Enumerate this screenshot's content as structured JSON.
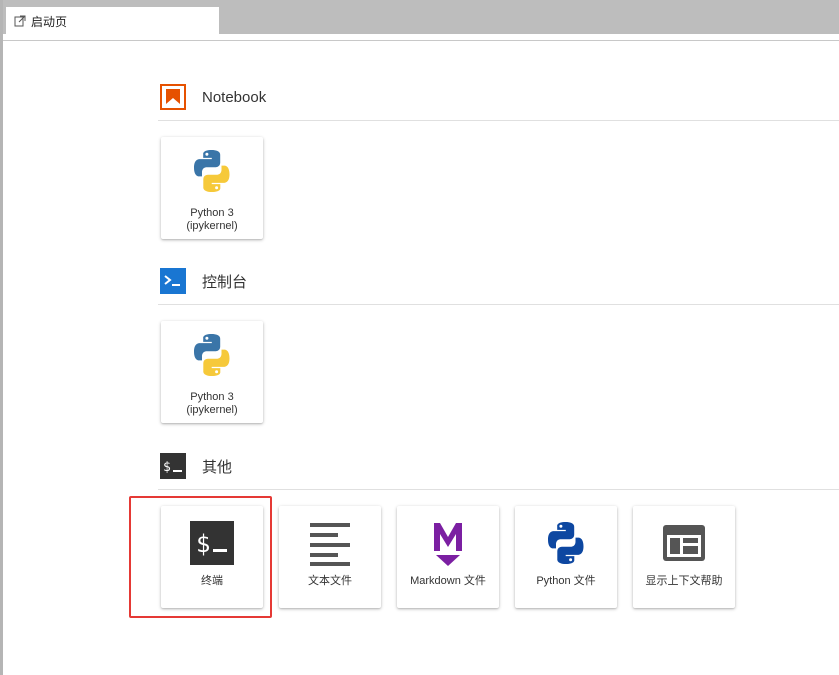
{
  "tab": {
    "title": "启动页",
    "icon": "launcher-icon"
  },
  "sections": {
    "notebook": {
      "title": "Notebook",
      "icon": "notebook-icon",
      "color": "#E65100"
    },
    "console": {
      "title": "控制台",
      "icon": "console-icon",
      "color": "#1976D2"
    },
    "other": {
      "title": "其他",
      "icon": "other-terminal-icon",
      "color": "#333333"
    }
  },
  "cards": {
    "notebook_python": {
      "label_line1": "Python 3",
      "label_line2": "(ipykernel)",
      "icon": "python-logo-icon"
    },
    "console_python": {
      "label_line1": "Python 3",
      "label_line2": "(ipykernel)",
      "icon": "python-logo-icon"
    },
    "terminal": {
      "label": "终端",
      "icon": "terminal-icon"
    },
    "text_file": {
      "label": "文本文件",
      "icon": "text-file-icon"
    },
    "markdown_file": {
      "label": "Markdown 文件",
      "icon": "markdown-icon",
      "color": "#7B1FA2"
    },
    "python_file": {
      "label": "Python 文件",
      "icon": "python-file-icon",
      "color": "#0D47A1"
    },
    "context_help": {
      "label": "显示上下文帮助",
      "icon": "context-help-icon"
    }
  },
  "highlight_color": "#E53935"
}
